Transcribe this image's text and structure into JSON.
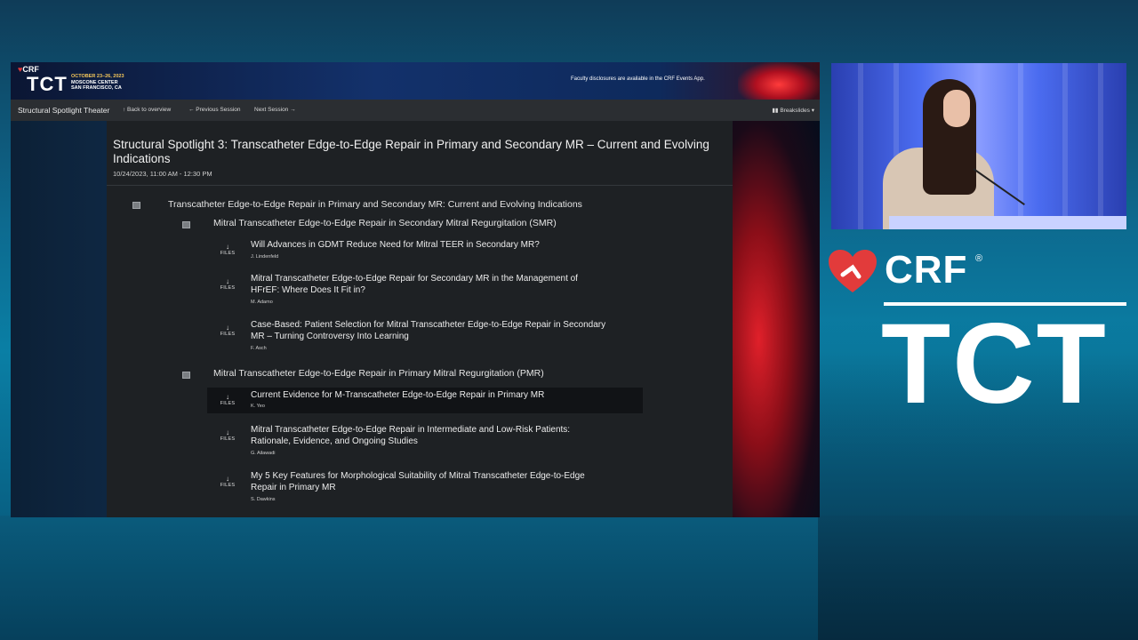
{
  "banner": {
    "crf": "CRF",
    "tct": "TCT",
    "dates": "OCTOBER 23–26, 2023",
    "venue": "MOSCONE CENTER",
    "city": "SAN FRANCISCO, CA",
    "disclosure": "Faculty disclosures are available in the CRF Events App."
  },
  "navbar": {
    "title": "Structural Spotlight Theater",
    "back": "↑ Back to overview",
    "previous": "← Previous Session",
    "next": "Next Session →",
    "breakslides": "▮▮ Breakslides ▾"
  },
  "session": {
    "title": "Structural Spotlight 3: Transcatheter Edge-to-Edge Repair in Primary and Secondary MR – Current and Evolving Indications",
    "time": "10/24/2023, 11:00 AM - 12:30 PM"
  },
  "tree": {
    "root": "Transcatheter Edge-to-Edge Repair in Primary and Secondary MR: Current and Evolving Indications",
    "group_smr": "Mitral Transcatheter Edge-to-Edge Repair in Secondary Mitral Regurgitation (SMR)",
    "group_pmr": "Mitral Transcatheter Edge-to-Edge Repair in Primary Mitral Regurgitation (PMR)",
    "files_label": "FILES",
    "arrow": "↓",
    "talks": [
      {
        "title": "Will Advances in GDMT Reduce Need for Mitral TEER in Secondary MR?",
        "author": "J. Lindenfeld"
      },
      {
        "title": "Mitral Transcatheter Edge-to-Edge Repair for Secondary MR in the Management of HFrEF: Where Does It Fit in?",
        "author": "M. Adamo"
      },
      {
        "title": "Case-Based: Patient Selection for Mitral Transcatheter Edge-to-Edge Repair in Secondary MR – Turning Controversy Into Learning",
        "author": "F. Asch"
      },
      {
        "title": "Current Evidence for M-Transcatheter Edge-to-Edge Repair in Primary MR",
        "author": "K. Yeo"
      },
      {
        "title": "Mitral Transcatheter Edge-to-Edge Repair in Intermediate and Low-Risk Patients: Rationale, Evidence, and Ongoing Studies",
        "author": "G. Ailawadi"
      },
      {
        "title": "My 5 Key Features for Morphological Suitability of Mitral Transcatheter Edge-to-Edge Repair in Primary MR",
        "author": "S. Dawkins"
      }
    ]
  },
  "brand": {
    "crf": "CRF",
    "reg": "®",
    "tct": "TCT"
  },
  "colors": {
    "accent_red": "#e23b3b",
    "nav_bg": "#2b2e32",
    "content_bg": "#1e2124"
  }
}
